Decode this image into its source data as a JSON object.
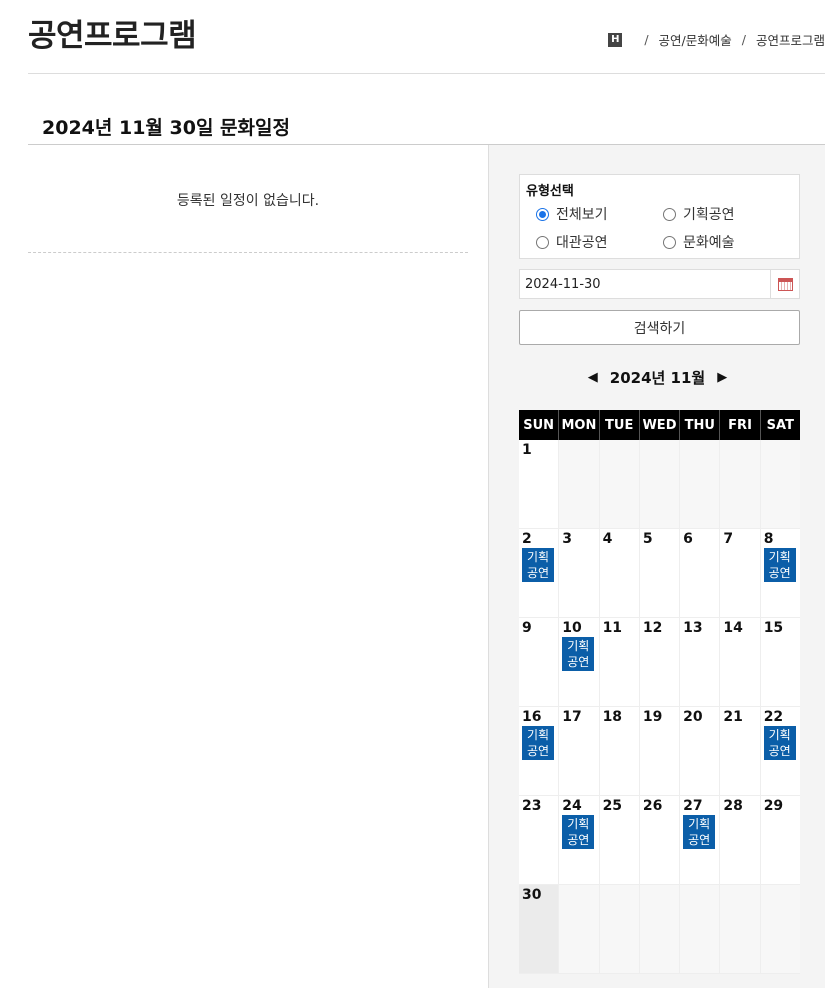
{
  "page": {
    "title": "공연프로그램",
    "breadcrumb": {
      "home_icon": "H",
      "items": [
        "공연/문화예술",
        "공연프로그램"
      ]
    },
    "date_heading": "2024년 11월 30일 문화일정",
    "empty_message": "등록된 일정이 없습니다."
  },
  "filter": {
    "title": "유형선택",
    "options": [
      {
        "label": "전체보기",
        "checked": true
      },
      {
        "label": "기획공연",
        "checked": false
      },
      {
        "label": "대관공연",
        "checked": false
      },
      {
        "label": "문화예술",
        "checked": false
      }
    ],
    "date_value": "2024-11-30",
    "search_label": "검색하기",
    "calendar_icon": "calendar-icon"
  },
  "calendar": {
    "month_label": "2024년 11월",
    "prev_arrow": "◀",
    "next_arrow": "▶",
    "weekdays": [
      "SUN",
      "MON",
      "TUE",
      "WED",
      "THU",
      "FRI",
      "SAT"
    ],
    "weeks": [
      [
        {
          "day": "1"
        },
        null,
        null,
        null,
        null,
        null,
        null
      ],
      [
        {
          "day": "2",
          "event": "기획공연"
        },
        {
          "day": "3"
        },
        {
          "day": "4"
        },
        {
          "day": "5"
        },
        {
          "day": "6"
        },
        {
          "day": "7"
        },
        {
          "day": "8",
          "event": "기획공연"
        }
      ],
      [
        {
          "day": "9"
        },
        {
          "day": "10",
          "event": "기획공연"
        },
        {
          "day": "11"
        },
        {
          "day": "12"
        },
        {
          "day": "13"
        },
        {
          "day": "14"
        },
        {
          "day": "15"
        }
      ],
      [
        {
          "day": "16",
          "event": "기획공연"
        },
        {
          "day": "17"
        },
        {
          "day": "18"
        },
        {
          "day": "19"
        },
        {
          "day": "20"
        },
        {
          "day": "21"
        },
        {
          "day": "22",
          "event": "기획공연"
        }
      ],
      [
        {
          "day": "23"
        },
        {
          "day": "24",
          "event": "기획공연"
        },
        {
          "day": "25"
        },
        {
          "day": "26"
        },
        {
          "day": "27",
          "event": "기획공연"
        },
        {
          "day": "28"
        },
        {
          "day": "29"
        }
      ],
      [
        {
          "day": "30",
          "today": true
        },
        null,
        null,
        null,
        null,
        null,
        null
      ]
    ]
  }
}
